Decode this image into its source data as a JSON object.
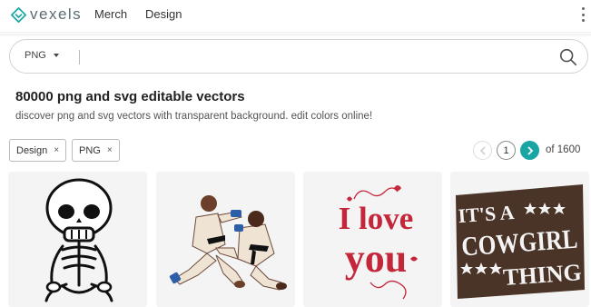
{
  "brand": {
    "logo_text": "vexels",
    "accent_color": "#1aa5a5",
    "logo_color": "#5b6b72"
  },
  "nav": {
    "links": [
      "Merch",
      "Design"
    ],
    "menu_icon": "kebab-menu-icon"
  },
  "search": {
    "type_value": "PNG",
    "query": "",
    "placeholder": "",
    "search_icon": "search-icon"
  },
  "heading": {
    "title": "80000 png and svg editable vectors",
    "subtitle": "discover png and svg vectors with transparent background. edit colors online!"
  },
  "filters": [
    {
      "label": "Design",
      "remove": "×"
    },
    {
      "label": "PNG",
      "remove": "×"
    }
  ],
  "pagination": {
    "current_page": "1",
    "of_text": "of 1600",
    "next_color": "#1aa5a5"
  },
  "results": [
    {
      "kind": "skeleton-illustration"
    },
    {
      "kind": "karate-fighters-illustration"
    },
    {
      "kind": "text-design",
      "line1": "I love",
      "line2": "you",
      "color": "#c4263a"
    },
    {
      "kind": "text-design",
      "line1": "IT'S A",
      "line2": "COWGIRL",
      "line3": "THING",
      "color": "#4a3427"
    }
  ]
}
